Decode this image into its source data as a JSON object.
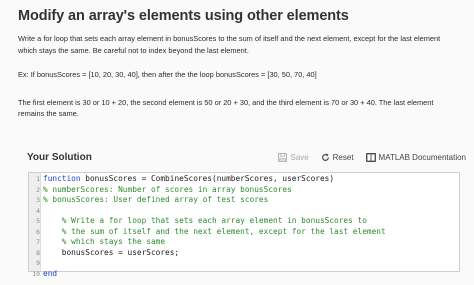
{
  "problem": {
    "title": "Modify an array's elements using other elements",
    "intro_line1": "Write a for loop that sets each array element in bonusScores to the sum of itself and the next element, except for the last element",
    "intro_line2": "which stays the same. Be careful not to index beyond the last element.",
    "example": "Ex: If bonusScores = [10, 20, 30, 40], then after the the loop bonusScores = [30, 50, 70, 40]",
    "explain_line1": "The first element is 30 or 10 + 20, the second element is 50 or 20 + 30, and the third element is 70 or 30 + 40. The last element",
    "explain_line2": "remains the same."
  },
  "solution": {
    "title": "Your Solution",
    "save_label": "Save",
    "reset_label": "Reset",
    "docs_label": "MATLAB Documentation"
  },
  "editor": {
    "lines": [
      {
        "num": "1",
        "kw": "function",
        "text": " bonusScores = CombineScores(numberScores, userScores)",
        "comment": false
      },
      {
        "num": "2",
        "kw": "",
        "text": "% numberScores: Number of scores in array bonusScores",
        "comment": true
      },
      {
        "num": "3",
        "kw": "",
        "text": "% bonusScores: User defined array of test scores",
        "comment": true
      },
      {
        "num": "4",
        "kw": "",
        "text": "",
        "comment": false
      },
      {
        "num": "5",
        "kw": "",
        "text": "    % Write a for loop that sets each array element in bonusScores to",
        "comment": true
      },
      {
        "num": "6",
        "kw": "",
        "text": "    % the sum of itself and the next element, except for the last element",
        "comment": true
      },
      {
        "num": "7",
        "kw": "",
        "text": "    % which stays the same",
        "comment": true
      },
      {
        "num": "8",
        "kw": "",
        "text": "    bonusScores = userScores;",
        "comment": false
      },
      {
        "num": "9",
        "kw": "",
        "text": "",
        "comment": false
      },
      {
        "num": "10",
        "kw": "end",
        "text": "",
        "comment": false
      }
    ]
  },
  "icons": {
    "save": "save-icon",
    "reset": "reset-icon",
    "docs": "matlab-doc-icon"
  },
  "colors": {
    "comment": "#2e8b2e",
    "keyword": "#1a3fd0",
    "gutter": "#eeeeee"
  }
}
